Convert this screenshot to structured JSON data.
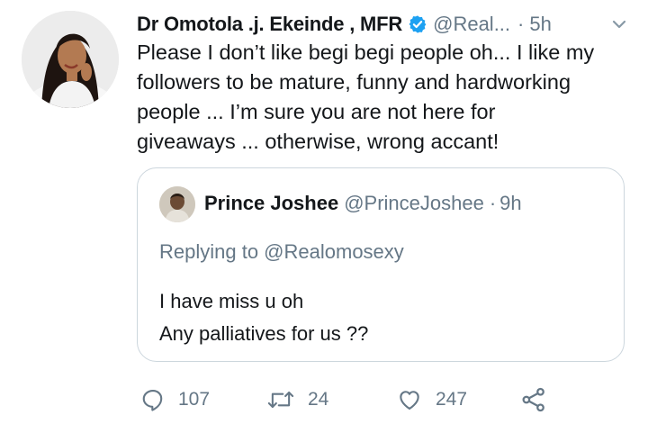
{
  "tweet": {
    "author_name": "Dr Omotola .j. Ekeinde , MFR",
    "handle": "@Real...",
    "separator": "·",
    "time": "5h",
    "text_lines": [
      "Please I don’t like begi begi people oh... I like my",
      "followers to be mature, funny and hardworking",
      "people ... I’m sure you are not here for",
      "giveaways ... otherwise, wrong accant!"
    ]
  },
  "quoted_tweet": {
    "author_name": "Prince Joshee",
    "handle": "@PrinceJoshee",
    "separator": "·",
    "time": "9h",
    "replying_to": "Replying to @Realomosexy",
    "text_lines": [
      "I have miss u oh",
      "Any palliatives for us ??"
    ]
  },
  "actions": {
    "reply_count": "107",
    "retweet_count": "24",
    "like_count": "247"
  },
  "icons": {
    "verified": "verified-badge-icon",
    "chevron": "chevron-down-icon",
    "reply": "reply-icon",
    "retweet": "retweet-icon",
    "like": "heart-icon",
    "share": "share-icon"
  },
  "colors": {
    "verified_blue": "#1da1f2",
    "secondary_text": "#657786",
    "primary_text": "#14171a",
    "border": "#ccd6dd"
  }
}
